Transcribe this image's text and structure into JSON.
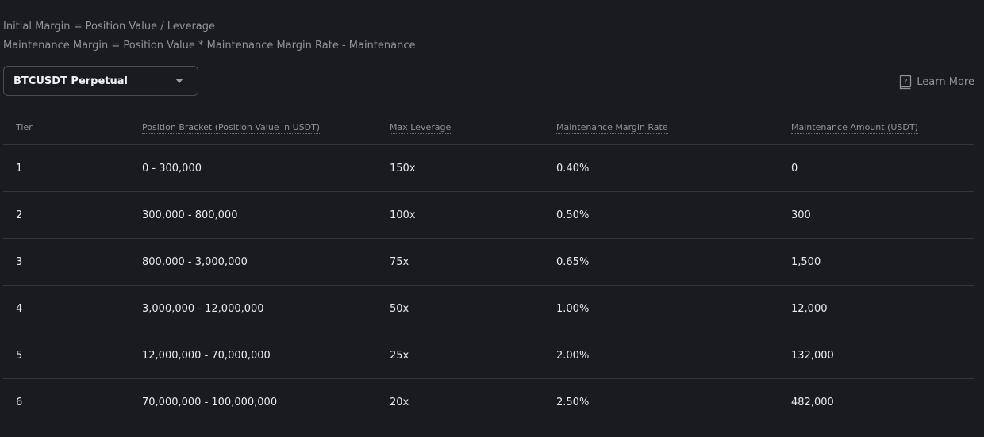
{
  "formulas": {
    "initial_margin": "Initial Margin = Position Value / Leverage",
    "maintenance_margin": "Maintenance Margin = Position Value * Maintenance Margin Rate - Maintenance"
  },
  "selector": {
    "label": "BTCUSDT Perpetual",
    "icon": "chevron-down-icon"
  },
  "learn_more": {
    "label": "Learn More",
    "icon": "book-question-icon"
  },
  "table": {
    "headers": {
      "tier": "Tier",
      "bracket": "Position Bracket (Position Value in USDT)",
      "leverage": "Max Leverage",
      "mmr": "Maintenance Margin Rate",
      "amount": "Maintenance Amount (USDT)"
    },
    "rows": [
      {
        "tier": "1",
        "bracket": "0 - 300,000",
        "leverage": "150x",
        "mmr": "0.40%",
        "amount": "0"
      },
      {
        "tier": "2",
        "bracket": "300,000 - 800,000",
        "leverage": "100x",
        "mmr": "0.50%",
        "amount": "300"
      },
      {
        "tier": "3",
        "bracket": "800,000 - 3,000,000",
        "leverage": "75x",
        "mmr": "0.65%",
        "amount": "1,500"
      },
      {
        "tier": "4",
        "bracket": "3,000,000 - 12,000,000",
        "leverage": "50x",
        "mmr": "1.00%",
        "amount": "12,000"
      },
      {
        "tier": "5",
        "bracket": "12,000,000 - 70,000,000",
        "leverage": "25x",
        "mmr": "2.00%",
        "amount": "132,000"
      },
      {
        "tier": "6",
        "bracket": "70,000,000 - 100,000,000",
        "leverage": "20x",
        "mmr": "2.50%",
        "amount": "482,000"
      }
    ]
  },
  "colors": {
    "background": "#1a1b20",
    "text_primary": "#e9eaec",
    "text_secondary": "#8f939c",
    "divider": "#34363c"
  }
}
